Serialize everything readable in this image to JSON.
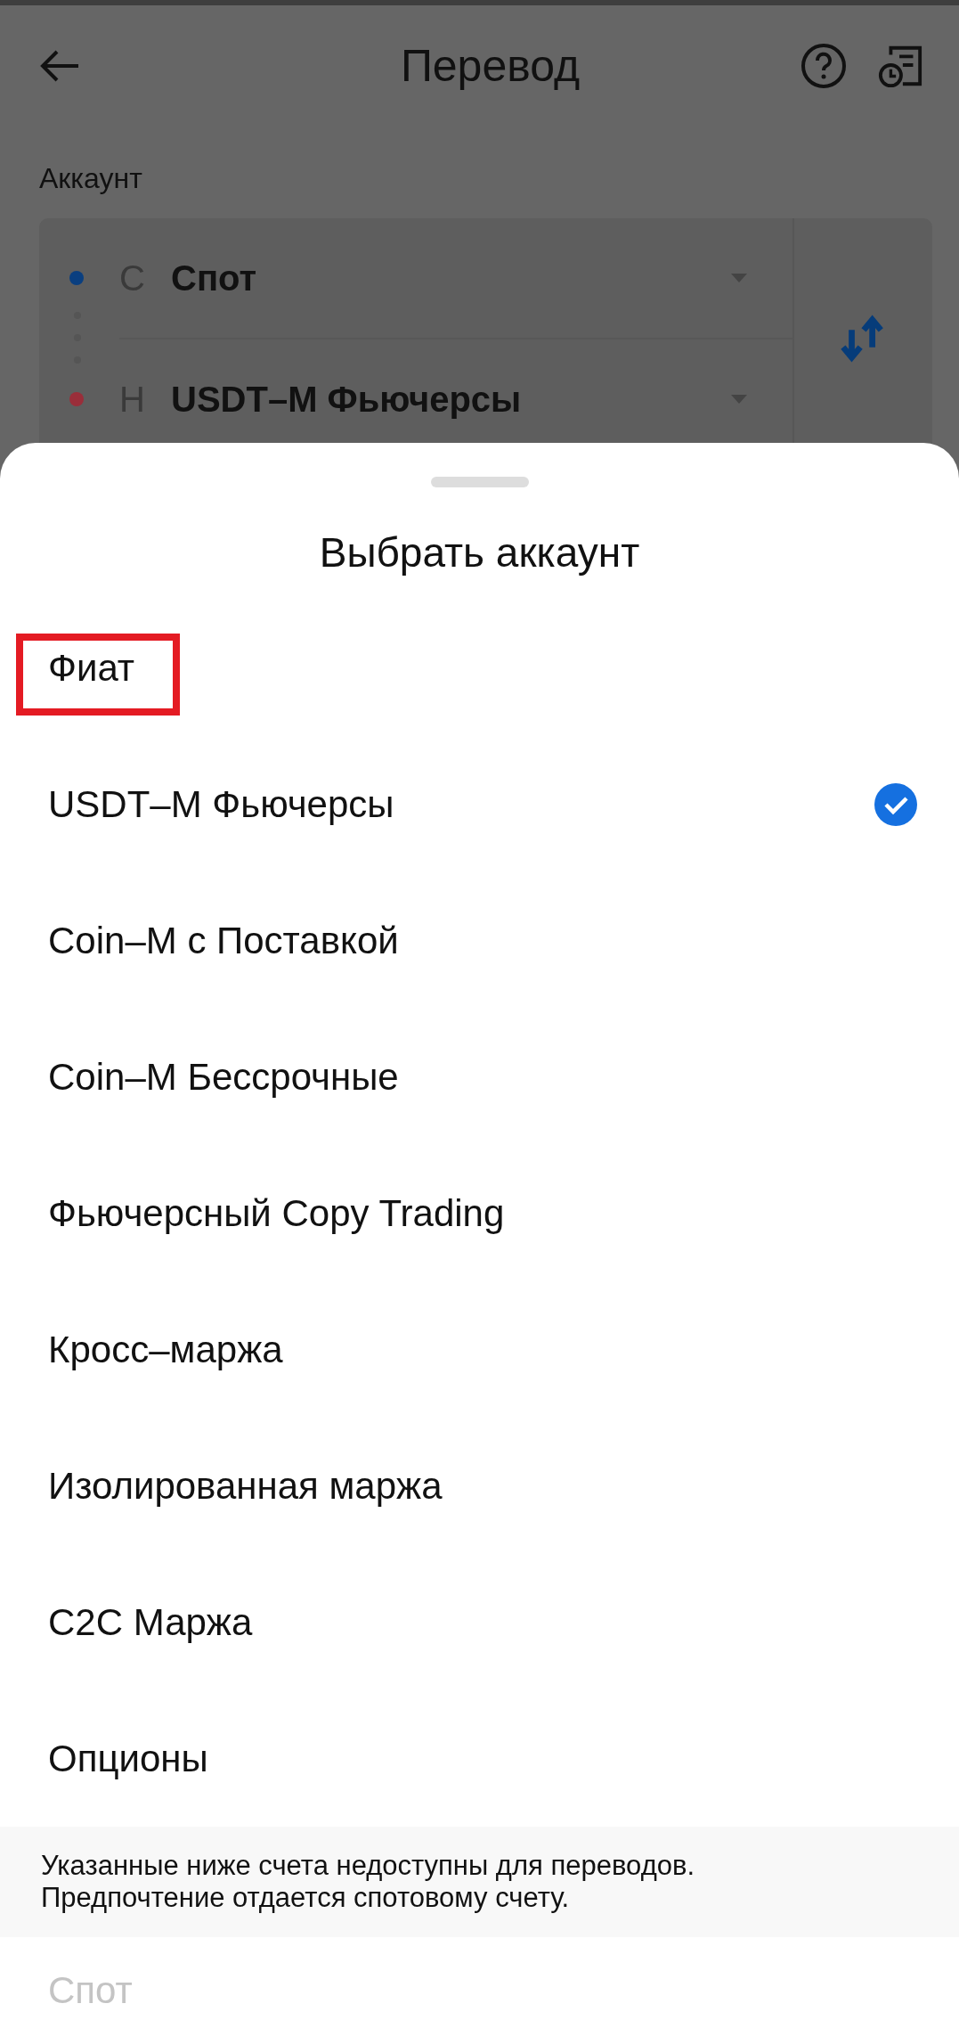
{
  "header": {
    "title": "Перевод"
  },
  "account_label": "Аккаунт",
  "transfer": {
    "from": {
      "letter": "С",
      "name": "Спот",
      "color": "#0a3f80"
    },
    "to": {
      "letter": "Н",
      "name": "USDT–M Фьючерсы",
      "color": "#9a2e3a"
    }
  },
  "sheet": {
    "title": "Выбрать аккаунт",
    "items": [
      {
        "label": "Фиат",
        "selected": false,
        "highlighted": true
      },
      {
        "label": "USDT–M Фьючерсы",
        "selected": true,
        "highlighted": false
      },
      {
        "label": "Coin–M с Поставкой",
        "selected": false,
        "highlighted": false
      },
      {
        "label": "Coin–M Бессрочные",
        "selected": false,
        "highlighted": false
      },
      {
        "label": "Фьючерсный Copy Trading",
        "selected": false,
        "highlighted": false
      },
      {
        "label": "Кросс–маржа",
        "selected": false,
        "highlighted": false
      },
      {
        "label": "Изолированная маржа",
        "selected": false,
        "highlighted": false
      },
      {
        "label": "C2C Маржа",
        "selected": false,
        "highlighted": false
      },
      {
        "label": "Опционы",
        "selected": false,
        "highlighted": false
      }
    ],
    "notice": "Указанные ниже счета недоступны для переводов. Предпочтение отдается спотовому счету.",
    "unavailable": [
      {
        "label": "Спот",
        "disabled": true
      }
    ]
  }
}
